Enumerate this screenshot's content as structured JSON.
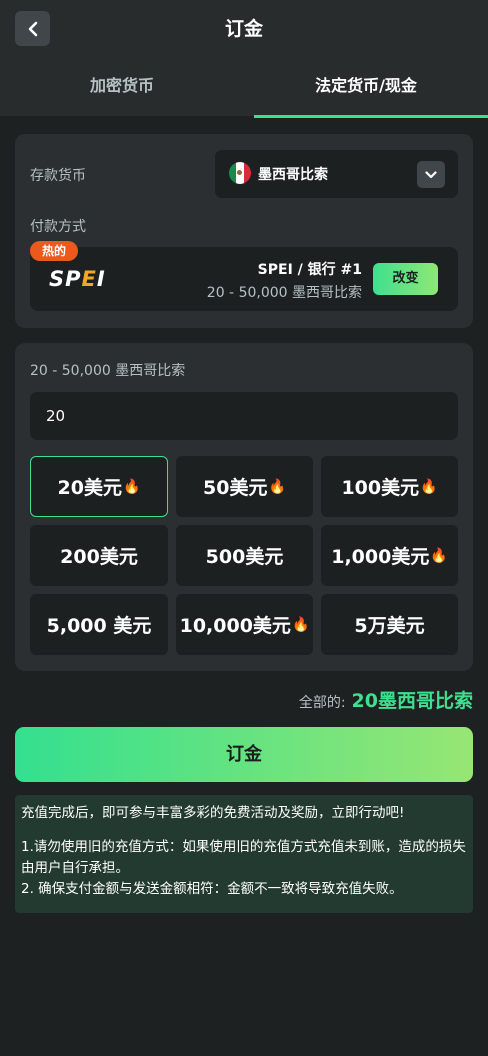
{
  "header": {
    "title": "订金"
  },
  "tabs": [
    {
      "label": "加密货币",
      "active": false
    },
    {
      "label": "法定货币/现金",
      "active": true
    }
  ],
  "deposit": {
    "currency_label": "存款货币",
    "currency_value": "墨西哥比索",
    "payment_label": "付款方式",
    "payment": {
      "badge": "热的",
      "logo_text": "SPEI",
      "name": "SPEI / 银行 #1",
      "range": "20 - 50,000 墨西哥比索",
      "change_label": "改变"
    }
  },
  "amount": {
    "range_label": "20 - 50,000 墨西哥比索",
    "input_value": "20",
    "options": [
      {
        "label": "20美元",
        "hot": true,
        "selected": true
      },
      {
        "label": "50美元",
        "hot": true,
        "selected": false
      },
      {
        "label": "100美元",
        "hot": true,
        "selected": false
      },
      {
        "label": "200美元",
        "hot": false,
        "selected": false
      },
      {
        "label": "500美元",
        "hot": false,
        "selected": false
      },
      {
        "label": "1,000美元",
        "hot": true,
        "selected": false
      },
      {
        "label": "5,000 美元",
        "hot": false,
        "selected": false
      },
      {
        "label": "10,000美元",
        "hot": true,
        "selected": false
      },
      {
        "label": "5万美元",
        "hot": false,
        "selected": false
      }
    ]
  },
  "total": {
    "label": "全部的:",
    "value": "20墨西哥比索"
  },
  "submit_label": "订金",
  "notice": {
    "line1": "充值完成后，即可参与丰富多彩的免费活动及奖励，立即行动吧!",
    "line2": "1.请勿使用旧的充值方式：如果使用旧的充值方式充值未到账，造成的损失由用户自行承担。",
    "line3": "2. 确保支付金额与发送金额相符：金额不一致将导致充值失败。"
  },
  "colors": {
    "accent": "#3ee08f",
    "background": "#1e2121",
    "card": "#2b2f31",
    "badge": "#ea5a1b"
  },
  "icons": {
    "back": "chevron-left-icon",
    "dropdown": "chevron-down-icon",
    "flag": "mexico-flag-icon",
    "hot": "fire-icon"
  }
}
